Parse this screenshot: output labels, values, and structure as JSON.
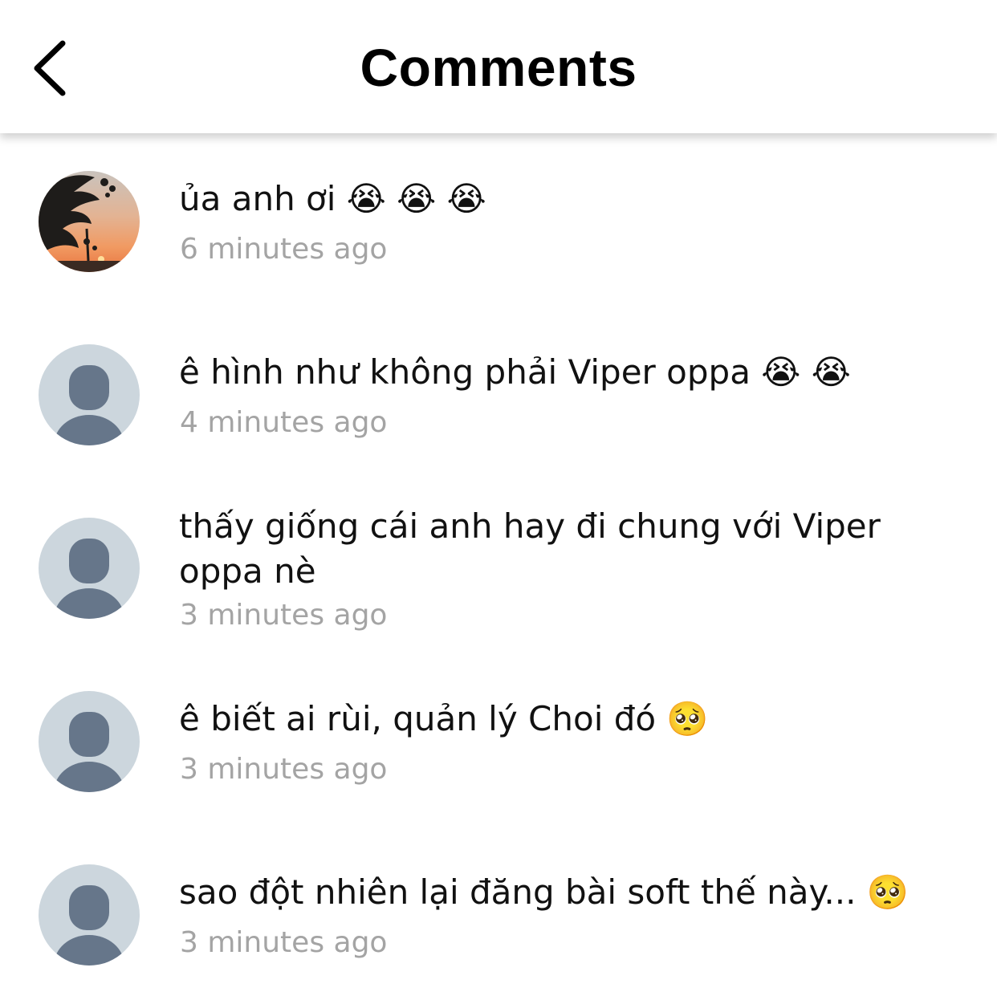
{
  "header": {
    "title": "Comments",
    "back_icon": "chevron-left-icon"
  },
  "colors": {
    "timestamp": "#a4a4a4",
    "avatar_placeholder_bg": "#ccd6dd",
    "avatar_placeholder_fg": "#66768a"
  },
  "comments": [
    {
      "text": "ủa anh ơi 😭 😭 😭",
      "time": "6 minutes ago",
      "avatar": "sunset-photo-avatar"
    },
    {
      "text": "ê hình như không phải Viper oppa 😭 😭",
      "time": "4 minutes ago",
      "avatar": "default-person-avatar"
    },
    {
      "text": "thấy giống cái anh hay đi chung với Viper oppa nè",
      "time": "3 minutes ago",
      "avatar": "default-person-avatar"
    },
    {
      "text": "ê biết ai rùi, quản lý Choi đó 🥺",
      "time": "3 minutes ago",
      "avatar": "default-person-avatar"
    },
    {
      "text": "sao đột nhiên lại đăng bài soft thế này... 🥺",
      "time": "3 minutes ago",
      "avatar": "default-person-avatar"
    }
  ]
}
